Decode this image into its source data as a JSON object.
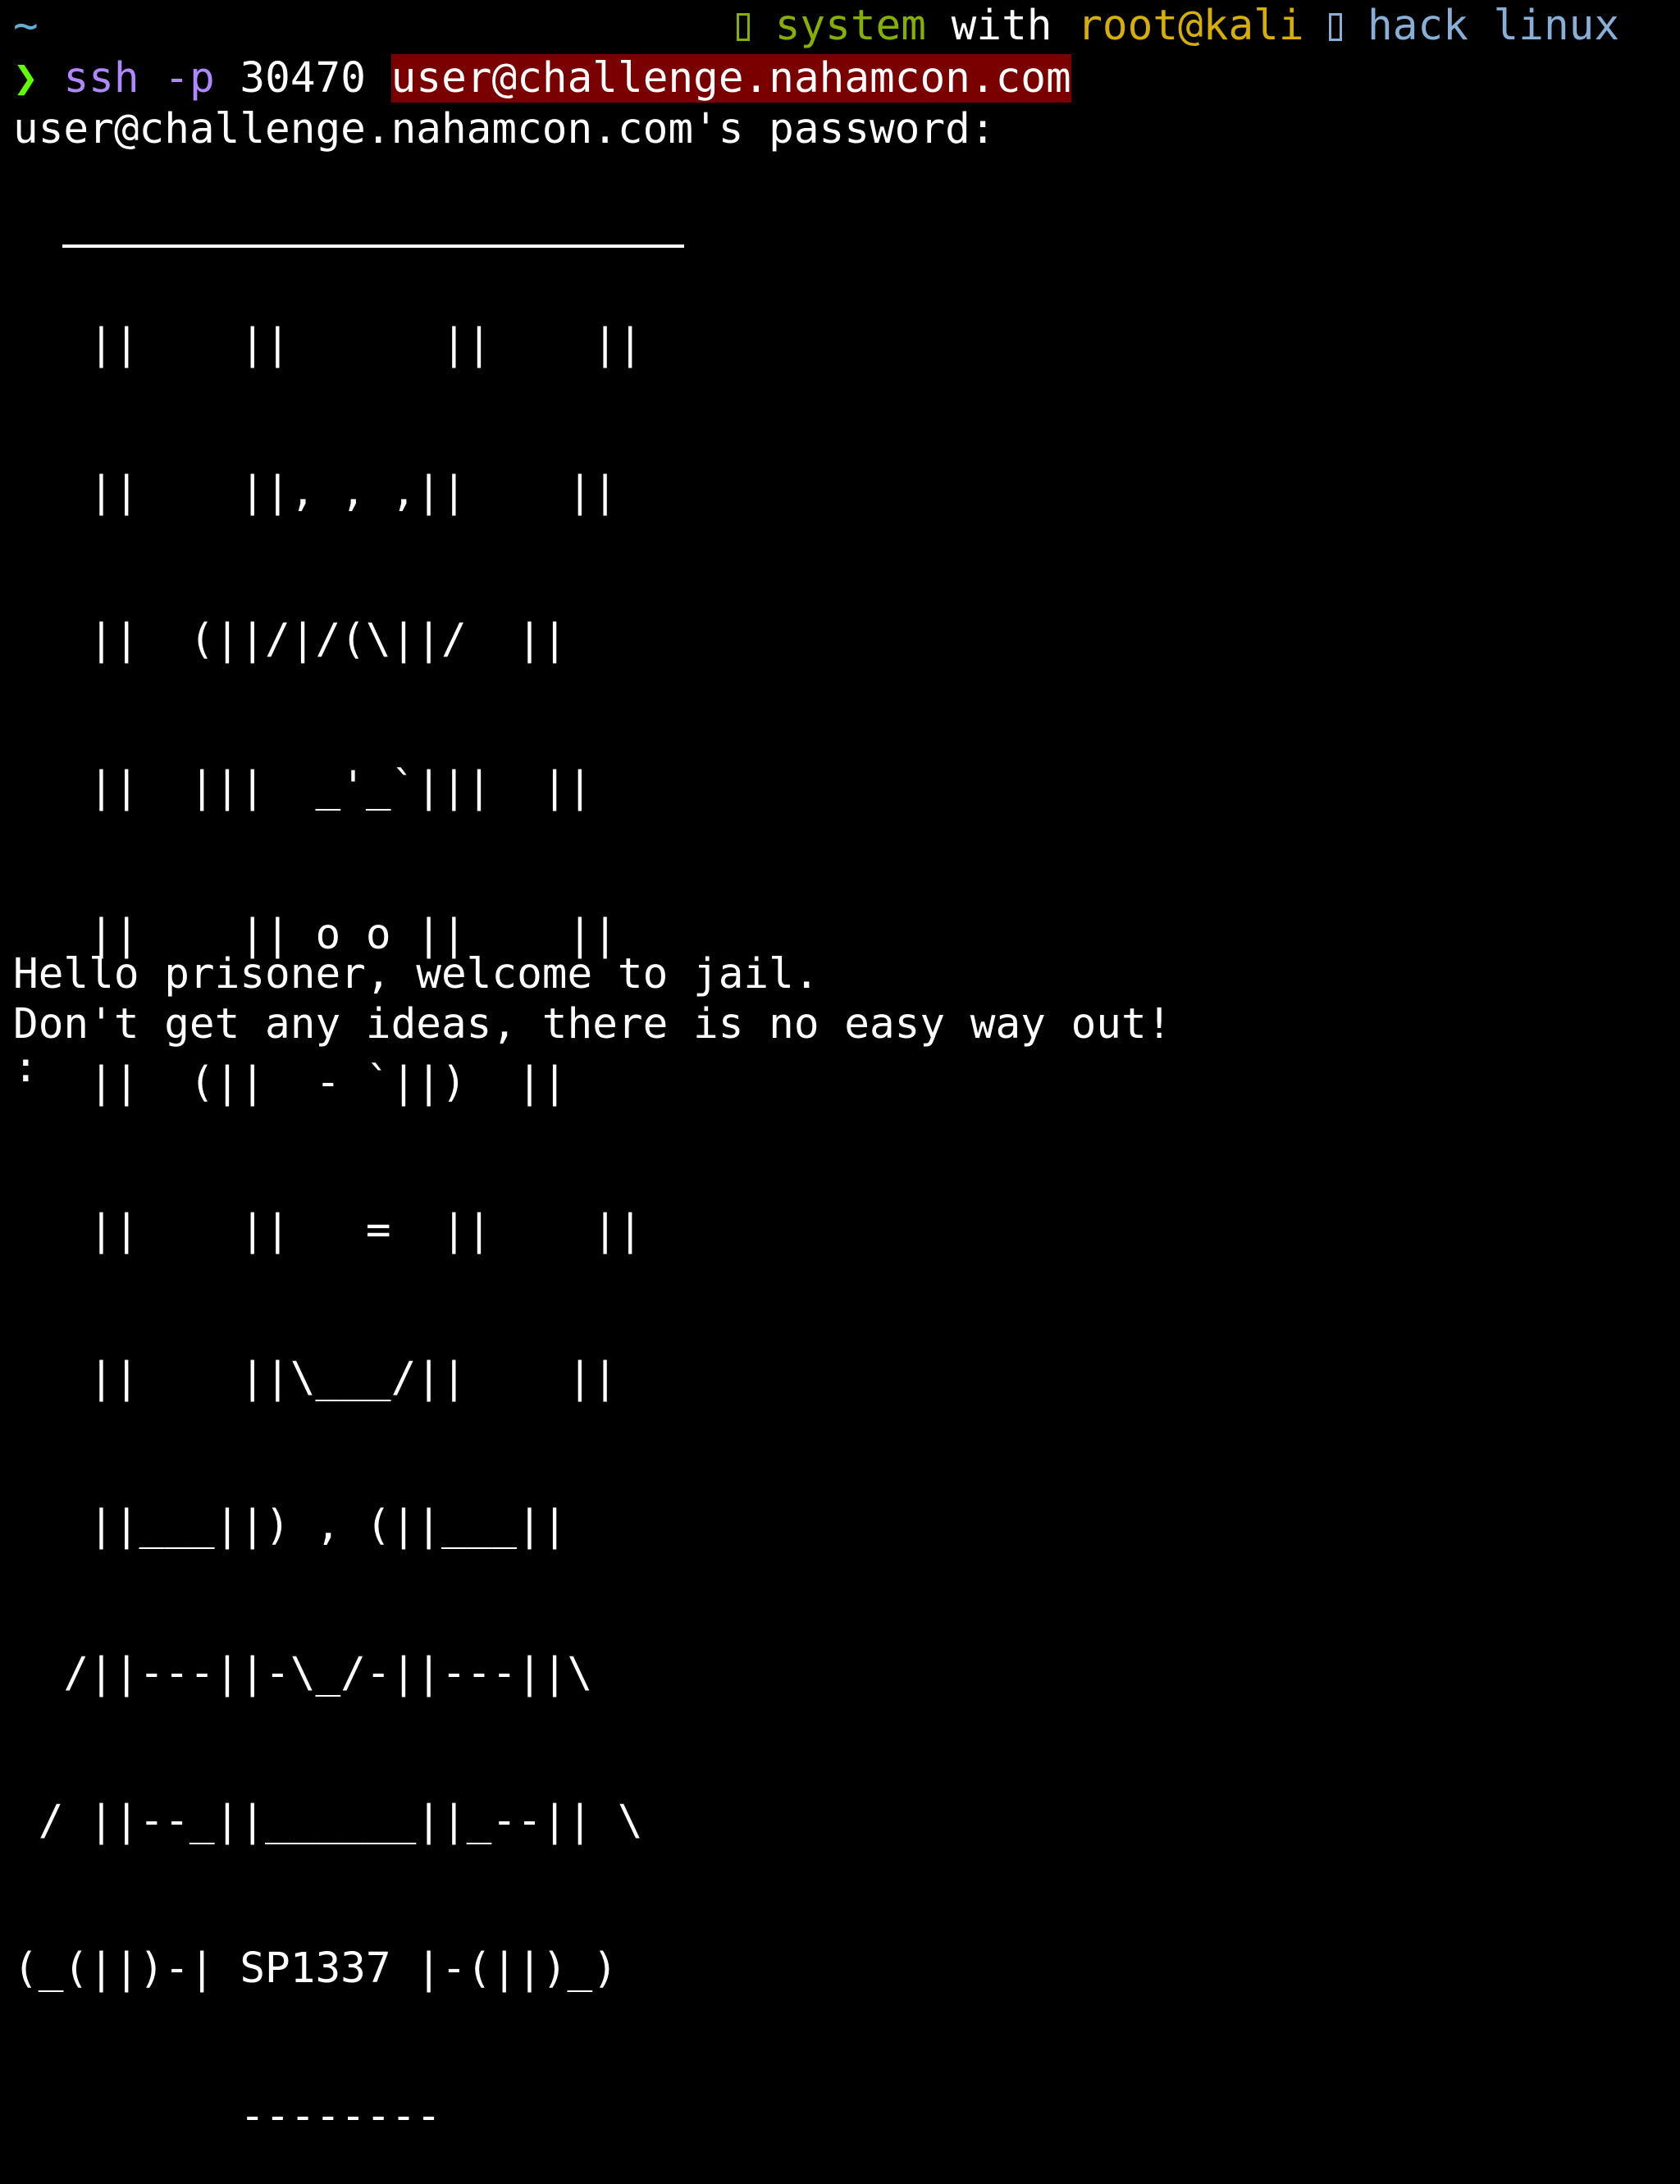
{
  "prompt_bar": {
    "tilde": "~",
    "system_word": "system",
    "with_word": "with",
    "user_host": "root@kali",
    "hack_word": "hack",
    "os_word": "linux"
  },
  "command": {
    "prompt_symbol": "❯",
    "cmd": "ssh",
    "flag": "-p",
    "port": "30470",
    "target": "user@challenge.nahamcon.com"
  },
  "password_prompt": "user@challenge.nahamcon.com's password:",
  "ascii_art": [
    "   ||    ||      ||    ||",
    "   ||    ||, , ,||    ||",
    "   ||  (||/|/(\\||/  ||",
    "   ||  |||  _'_`|||  ||",
    "   ||    || o o ||    ||",
    "   ||  (||  - `||)  ||",
    "   ||    ||   =  ||    ||",
    "   ||    ||\\___/||    ||",
    "   ||___||) , (||___||",
    "  /||---||-\\_/-||---||\\",
    " / ||--_||______||_--|| \\",
    "(_(||)-| SP1337 |-(||)_)",
    "         --------"
  ],
  "messages": {
    "line1": "Hello prisoner, welcome to jail.",
    "line2": "Don't get any ideas, there is no easy way out!",
    "input_prompt": ":"
  },
  "colors": {
    "background": "#000000",
    "text": "#ffffff",
    "tilde": "#5fafd7",
    "system_green": "#87af00",
    "user_host_yellow": "#d7af00",
    "hack_linux_blue": "#87afd7",
    "prompt_arrow": "#5fff00",
    "cmd_purple": "#af87ff",
    "highlight_bg": "#7a0000"
  }
}
